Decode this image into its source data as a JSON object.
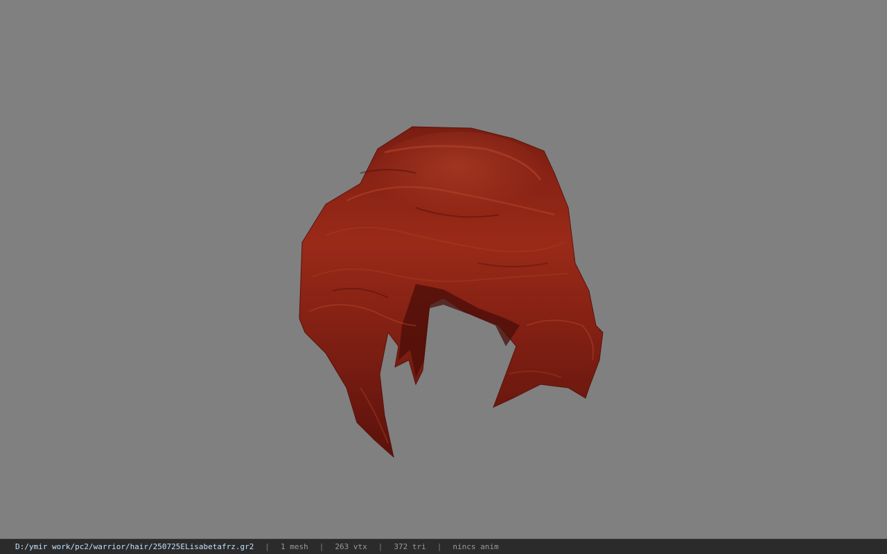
{
  "viewer": {
    "background_color": "#808080",
    "model_primary_color": "#8a2416",
    "model_highlight_color": "#b8452a",
    "model_shadow_color": "#4a0e08"
  },
  "statusbar": {
    "file_path": "D:/ymir work/pc2/warrior/hair/250725ELisabetafrz.gr2",
    "separator": "|",
    "mesh_count": "1 mesh",
    "vertex_count": "263 vtx",
    "triangle_count": "372 tri",
    "anim_status": "nincs anim"
  }
}
